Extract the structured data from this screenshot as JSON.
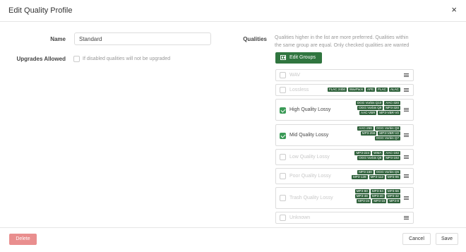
{
  "modal": {
    "title": "Edit Quality Profile",
    "close_glyph": "×"
  },
  "form": {
    "name_label": "Name",
    "name_value": "Standard",
    "upgrades_label": "Upgrades Allowed",
    "upgrades_help": "If disabled qualities will not be upgraded",
    "upgrades_checked": false,
    "qualities_label": "Qualities",
    "qualities_help_1": "Qualities higher in the list are more preferred. Qualities within",
    "qualities_help_2": "the same group are equal. Only checked qualities are wanted",
    "edit_groups_label": "Edit Groups"
  },
  "qualities": [
    {
      "name": "WAV",
      "checked": false,
      "tags": []
    },
    {
      "name": "Lossless",
      "checked": false,
      "tags": [
        "FLAC 24bit",
        "WavPack",
        "APE",
        "FLAC",
        "ALAC"
      ]
    },
    {
      "name": "High Quality Lossy",
      "checked": true,
      "tags": [
        "OGG Vorbis Q10",
        "AAC-320",
        "OGG Vorbis Q9",
        "MP3-320",
        "AAC-VBR",
        "MP3-VBR-V0"
      ]
    },
    {
      "name": "Mid Quality Lossy",
      "checked": true,
      "tags": [
        "AAC-256",
        "OGG Vorbis Q8",
        "MP3-256",
        "MP3-VBR-V2",
        "OGG Vorbis Q7"
      ]
    },
    {
      "name": "Low Quality Lossy",
      "checked": false,
      "tags": [
        "MP3-224",
        "WMA",
        "AAC-192",
        "OGG Vorbis Q6",
        "MP3-192"
      ]
    },
    {
      "name": "Poor Quality Lossy",
      "checked": false,
      "tags": [
        "MP3-160",
        "OGG Vorbis Q5",
        "MP3-128",
        "MP3-112",
        "MP3-96"
      ]
    },
    {
      "name": "Trash Quality Lossy",
      "checked": false,
      "tags": [
        "MP3-80",
        "MP3-64",
        "MP3-56",
        "MP3-48",
        "MP3-40",
        "MP3-32",
        "MP3-24",
        "MP3-16",
        "MP3-8"
      ]
    },
    {
      "name": "Unknown",
      "checked": false,
      "tags": []
    }
  ],
  "footer": {
    "delete_label": "Delete",
    "cancel_label": "Cancel",
    "save_label": "Save"
  },
  "colors": {
    "accent": "#30753f",
    "tag_bg": "#30623c",
    "delete_bg": "#e98e8e",
    "check": "#3a9a56"
  },
  "icons": {
    "close": "close-icon",
    "groups": "edit-groups-icon",
    "drag": "drag-handle-icon",
    "checkbox": "checkbox-icon"
  }
}
